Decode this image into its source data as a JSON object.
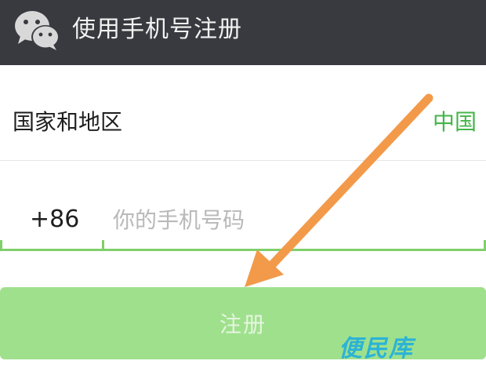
{
  "header": {
    "title": "使用手机号注册",
    "logo_icon": "wechat-logo-icon",
    "background": "#393a3f"
  },
  "country": {
    "label": "国家和地区",
    "value": "中国",
    "value_color": "#44b549"
  },
  "phone": {
    "country_code": "+86",
    "placeholder": "你的手机号码",
    "value": ""
  },
  "register": {
    "label": "注册",
    "background": "#9fe08d"
  },
  "annotation": {
    "arrow_icon": "arrow-icon",
    "arrow_color": "#f29a4a"
  },
  "watermark": {
    "text": "便民库"
  }
}
